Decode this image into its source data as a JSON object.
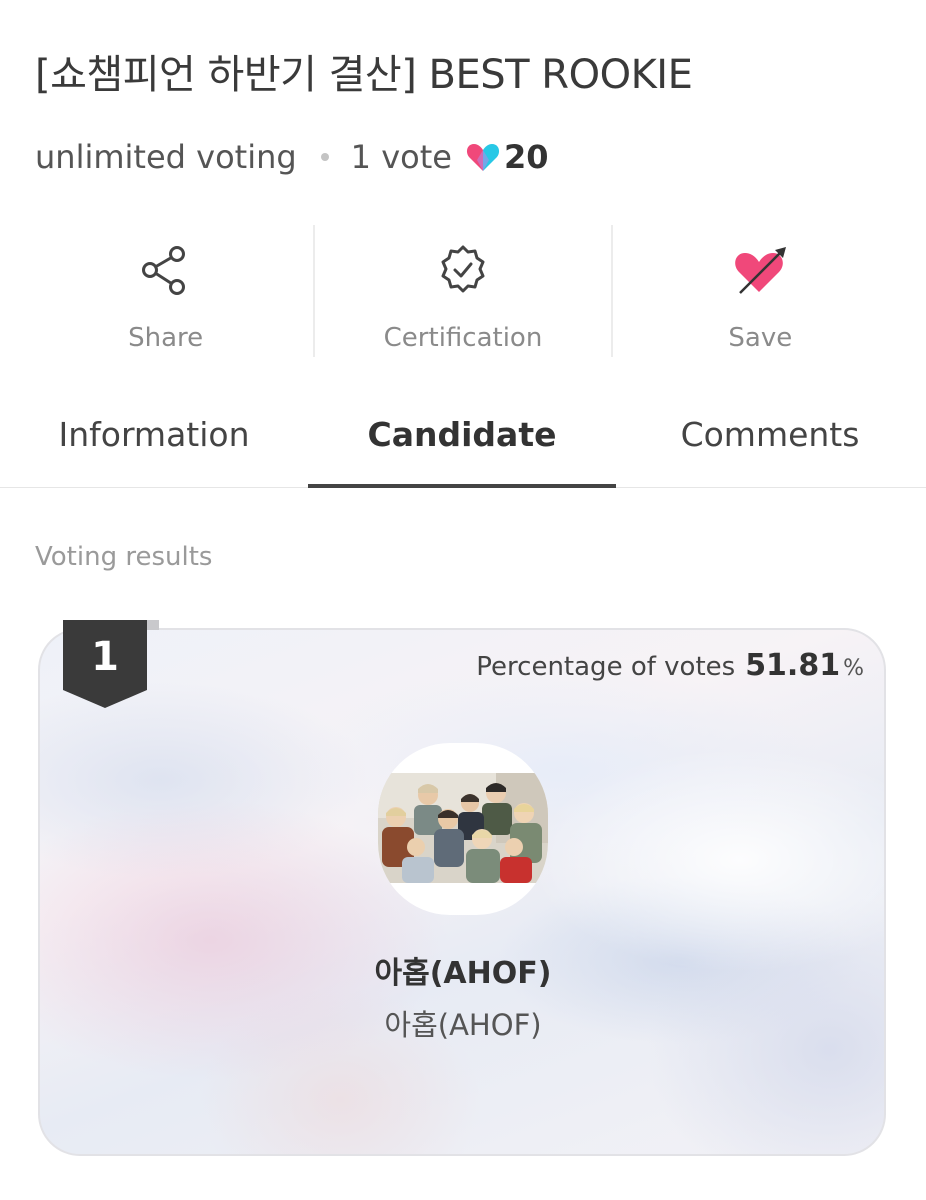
{
  "header": {
    "title": "[쇼챔피언 하반기 결산] BEST ROOKIE",
    "voting_type": "unlimited voting",
    "vote_cost": "1 vote",
    "heart_icon": "heart-gem-icon",
    "heart_count": "20",
    "accent_pink": "#f0487a",
    "accent_cyan": "#28c8e6"
  },
  "actions": [
    {
      "label": "Share",
      "icon": "share-icon"
    },
    {
      "label": "Certification",
      "icon": "certification-badge-icon"
    },
    {
      "label": "Save",
      "icon": "heart-arrow-icon"
    }
  ],
  "tabs": [
    {
      "label": "Information",
      "active": false
    },
    {
      "label": "Candidate",
      "active": true
    },
    {
      "label": "Comments",
      "active": false
    }
  ],
  "results": {
    "section_label": "Voting results",
    "candidates": [
      {
        "rank": "1",
        "percentage_label": "Percentage of votes",
        "percentage_value": "51.81",
        "percentage_unit": "%",
        "name": "아홉(AHOF)",
        "subtitle": "아홉(AHOF)"
      }
    ]
  }
}
